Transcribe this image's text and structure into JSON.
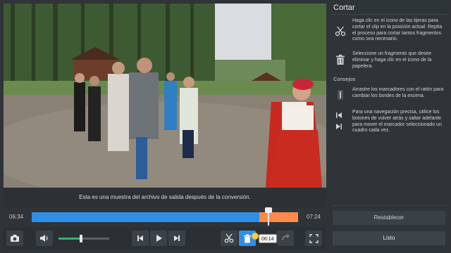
{
  "video": {
    "caption": "Esta es una muestra del archivo de salida después de la conversión."
  },
  "timeline": {
    "start_time": "06:34",
    "end_time": "07:24",
    "selected_fraction": 0.855,
    "playhead_fraction": 0.885,
    "tooltip": "06:14"
  },
  "controls": {
    "volume_fraction": 0.45,
    "icons": [
      "camera-icon",
      "speaker-icon",
      "skip-back-icon",
      "play-icon",
      "skip-forward-icon",
      "scissors-icon",
      "trash-icon",
      "redo-icon",
      "fullscreen-icon"
    ]
  },
  "panel": {
    "title": "Cortar",
    "tip_cut": "Haga clic en el icono de las tijeras para cortar el clip en la posición actual. Repita el proceso para cortar tantos fragmentos como sea necesario.",
    "tip_delete": "Seleccione un fragmento que desee eliminar y haga clic en el icono de la papelera.",
    "tips_header": "Consejos",
    "tip_drag": "Arrastre los marcadores con el ratón para cambiar los bordes de la escena.",
    "tip_nav": "Para una navegación precisa, utilice los botones de volver atrás y saltar adelante para mover el marcador seleccionado un cuadro cada vez.",
    "reset_label": "Restablecer",
    "done_label": "Listo"
  },
  "colors": {
    "selected_segment": "#2f8fe6",
    "remaining_segment": "#ff8a4a",
    "volume": "#2bb573"
  }
}
